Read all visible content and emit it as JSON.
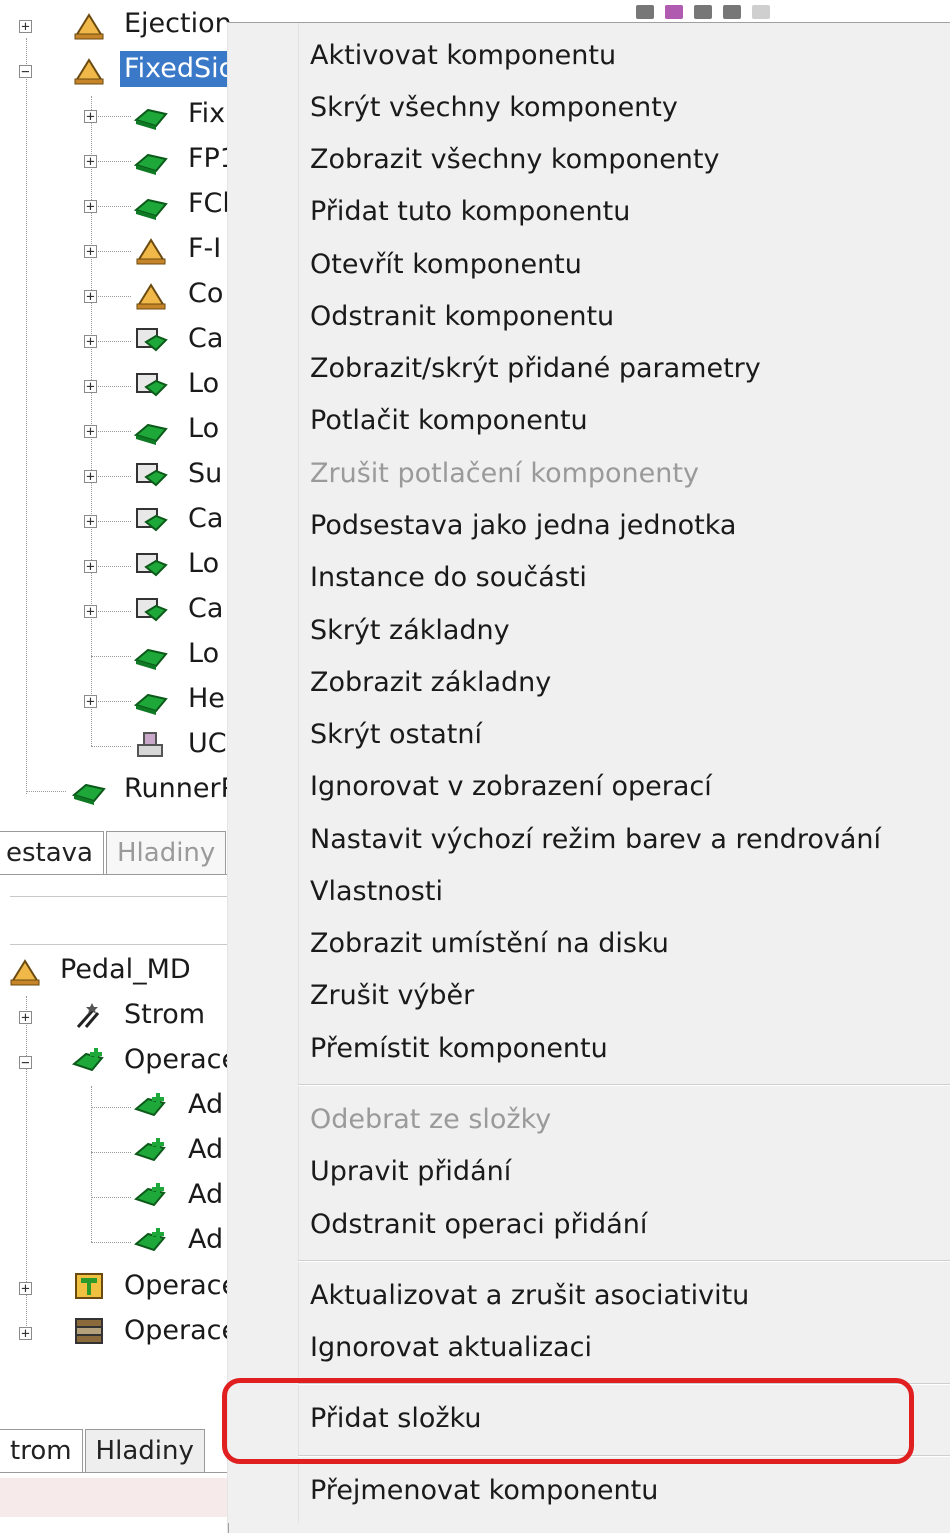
{
  "tree_top": {
    "items": [
      {
        "label": "Ejection",
        "expander": "+"
      },
      {
        "label": "FixedSid",
        "expander": "−"
      },
      {
        "label": "Fix",
        "expander": "+"
      },
      {
        "label": "FP1",
        "expander": "+"
      },
      {
        "label": "FCl",
        "expander": "+"
      },
      {
        "label": "F-I",
        "expander": "+"
      },
      {
        "label": "Co",
        "expander": "+"
      },
      {
        "label": "Ca",
        "expander": "+"
      },
      {
        "label": "Lo",
        "expander": "+"
      },
      {
        "label": "Lo",
        "expander": "+"
      },
      {
        "label": "Su",
        "expander": "+"
      },
      {
        "label": "Ca",
        "expander": "+"
      },
      {
        "label": "Lo",
        "expander": "+"
      },
      {
        "label": "Ca",
        "expander": "+"
      },
      {
        "label": "Lo",
        "expander": ""
      },
      {
        "label": "He",
        "expander": "+"
      },
      {
        "label": "UC",
        "expander": ""
      },
      {
        "label": "RunnerP",
        "expander": ""
      }
    ],
    "tabs": {
      "estava": "estava",
      "hladiny": "Hladiny"
    }
  },
  "tree_bottom": {
    "items": [
      {
        "label": "Pedal_MD",
        "expander": ""
      },
      {
        "label": "Strom",
        "expander": "+"
      },
      {
        "label": "Operace",
        "expander": "−"
      },
      {
        "label": "Ad",
        "expander": ""
      },
      {
        "label": "Ad",
        "expander": ""
      },
      {
        "label": "Ad",
        "expander": ""
      },
      {
        "label": "Ad",
        "expander": ""
      },
      {
        "label": "Operace",
        "expander": "+"
      },
      {
        "label": "Operace",
        "expander": "+"
      }
    ],
    "tabs": {
      "strom": "trom",
      "hladiny": "Hladiny"
    }
  },
  "context_menu": {
    "items": [
      {
        "label": "Aktivovat komponentu",
        "disabled": false
      },
      {
        "label": "Skrýt všechny komponenty",
        "disabled": false
      },
      {
        "label": "Zobrazit všechny komponenty",
        "disabled": false
      },
      {
        "label": "Přidat tuto komponentu",
        "disabled": false
      },
      {
        "label": "Otevřít komponentu",
        "disabled": false
      },
      {
        "label": "Odstranit komponentu",
        "disabled": false
      },
      {
        "label": "Zobrazit/skrýt přidané parametry",
        "disabled": false
      },
      {
        "label": "Potlačit komponentu",
        "disabled": false
      },
      {
        "label": "Zrušit potlačení komponenty",
        "disabled": true
      },
      {
        "label": "Podsestava jako jedna jednotka",
        "disabled": false
      },
      {
        "label": "Instance do součásti",
        "disabled": false
      },
      {
        "label": "Skrýt základny",
        "disabled": false
      },
      {
        "label": "Zobrazit základny",
        "disabled": false
      },
      {
        "label": "Skrýt ostatní",
        "disabled": false
      },
      {
        "label": "Ignorovat v zobrazení operací",
        "disabled": false
      },
      {
        "label": "Nastavit výchozí režim barev a rendrování",
        "disabled": false
      },
      {
        "label": "Vlastnosti",
        "disabled": false
      },
      {
        "label": "Zobrazit umístění na disku",
        "disabled": false
      },
      {
        "label": "Zrušit výběr",
        "disabled": false
      },
      {
        "label": "Přemístit komponentu",
        "disabled": false
      },
      {
        "label": "Odebrat ze složky",
        "disabled": true
      },
      {
        "label": "Upravit přidání",
        "disabled": false
      },
      {
        "label": "Odstranit operaci přidání",
        "disabled": false
      },
      {
        "label": "Aktualizovat a zrušit asociativitu",
        "disabled": false
      },
      {
        "label": "Ignorovat aktualizaci",
        "disabled": false
      },
      {
        "label": "Přidat složku",
        "disabled": false,
        "highlighted": true
      },
      {
        "label": "Přejmenovat komponentu",
        "disabled": false
      }
    ]
  },
  "colors": {
    "highlight_outline": "#e02020",
    "selection": "#3a78c8",
    "menu_background": "#f0f0f0",
    "disabled_text": "#9a9a9a"
  }
}
